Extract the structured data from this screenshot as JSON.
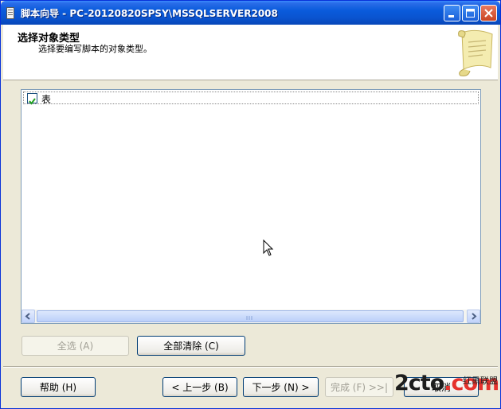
{
  "window": {
    "title": "脚本向导 - PC-20120820SPSY\\MSSQLSERVER2008",
    "icon": "wizard-icon"
  },
  "header": {
    "title": "选择对象类型",
    "subtitle": "选择要编写脚本的对象类型。",
    "icon": "scroll-icon"
  },
  "object_list": {
    "items": [
      {
        "label": "表",
        "checked": true
      }
    ]
  },
  "buttons": {
    "select_all": "全选 (A)",
    "clear_all": "全部清除 (C)",
    "help": "帮助 (H)",
    "previous": "< 上一步 (B)",
    "next": "下一步 (N) >",
    "finish": "完成 (F) >>|",
    "cancel": "取消"
  },
  "watermark": {
    "main": "2cto",
    "dot_suffix": ".com",
    "side_text": "红黑联盟"
  },
  "colors": {
    "titlebar": "#0a54d0",
    "window_bg": "#ece9d8",
    "close_button": "#c94423",
    "list_border": "#7f9db9"
  }
}
